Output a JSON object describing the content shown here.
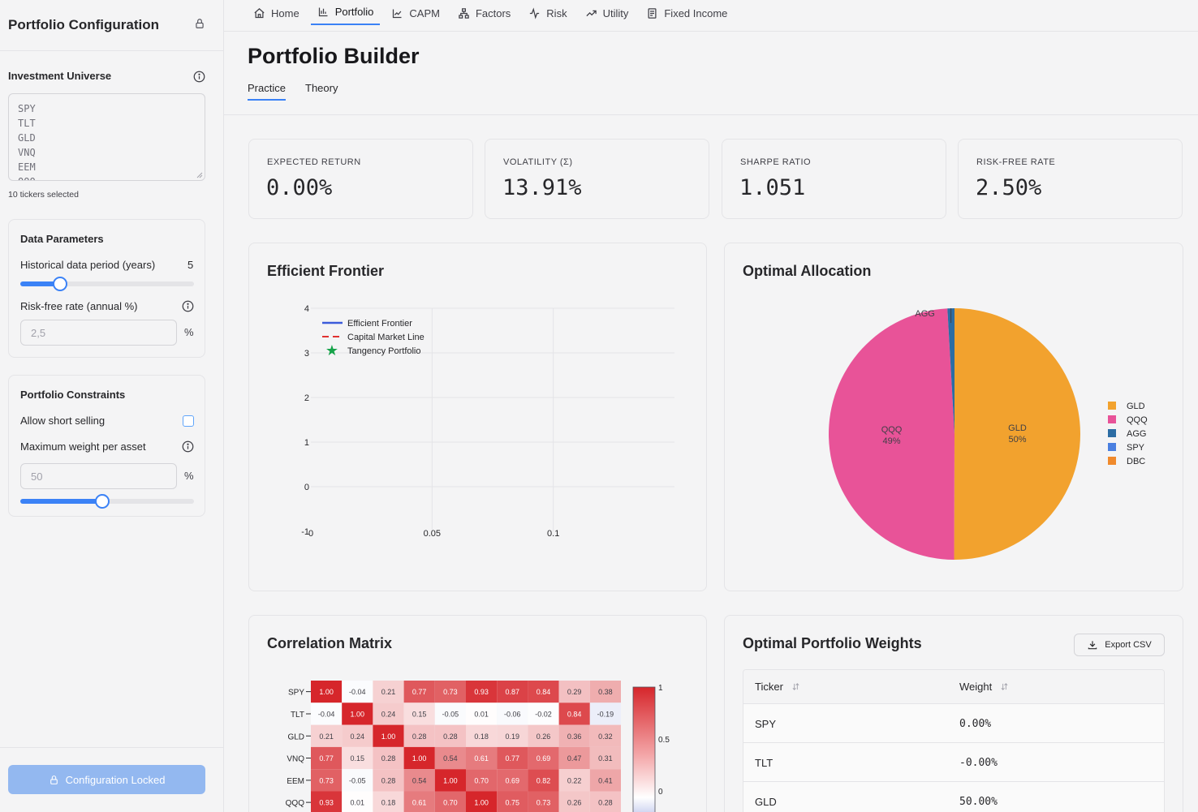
{
  "sidebar": {
    "title": "Portfolio Configuration",
    "universe_label": "Investment Universe",
    "tickers_text": "SPY\nTLT\nGLD\nVNQ\nEEM\nQQQ",
    "tickers_selected": "10 tickers selected",
    "data_params": {
      "title": "Data Parameters",
      "history_label": "Historical data period (years)",
      "history_value": "5",
      "history_fraction": 0.23,
      "rf_label": "Risk-free rate (annual %)",
      "rf_placeholder": "2,5",
      "pct": "%"
    },
    "constraints": {
      "title": "Portfolio Constraints",
      "short_label": "Allow short selling",
      "short_checked": false,
      "maxw_label": "Maximum weight per asset",
      "maxw_placeholder": "50",
      "maxw_fraction": 0.47,
      "pct": "%"
    },
    "locked_button": "Configuration Locked"
  },
  "nav": {
    "items": [
      {
        "label": "Home",
        "icon": "home-icon"
      },
      {
        "label": "Portfolio",
        "icon": "bar-chart-icon",
        "active": true
      },
      {
        "label": "CAPM",
        "icon": "line-chart-icon"
      },
      {
        "label": "Factors",
        "icon": "network-icon"
      },
      {
        "label": "Risk",
        "icon": "activity-icon"
      },
      {
        "label": "Utility",
        "icon": "trending-up-icon"
      },
      {
        "label": "Fixed Income",
        "icon": "document-icon"
      }
    ]
  },
  "page": {
    "title": "Portfolio Builder",
    "tabs": [
      "Practice",
      "Theory"
    ]
  },
  "metrics": [
    {
      "label": "EXPECTED RETURN",
      "value": "0.00%"
    },
    {
      "label": "VOLATILITY (Σ)",
      "value": "13.91%"
    },
    {
      "label": "SHARPE RATIO",
      "value": "1.051"
    },
    {
      "label": "RISK-FREE RATE",
      "value": "2.50%"
    }
  ],
  "frontier": {
    "title": "Efficient Frontier"
  },
  "allocation": {
    "title": "Optimal Allocation"
  },
  "correlation": {
    "title": "Correlation Matrix"
  },
  "weights": {
    "title": "Optimal Portfolio Weights",
    "export_label": "Export CSV",
    "columns": [
      "Ticker",
      "Weight"
    ],
    "rows": [
      {
        "ticker": "SPY",
        "weight": "0.00%"
      },
      {
        "ticker": "TLT",
        "weight": "-0.00%"
      },
      {
        "ticker": "GLD",
        "weight": "50.00%"
      }
    ]
  },
  "colors": {
    "accent": "#3b82f6",
    "gld": "#f2a22e",
    "qqq": "#e85398",
    "agg": "#2c6da4",
    "spy": "#4a7fe0",
    "dbc": "#f08a2c"
  },
  "chart_data": [
    {
      "type": "line",
      "title": "Efficient Frontier",
      "xlim": [
        0,
        0.15
      ],
      "ylim": [
        -1,
        4
      ],
      "x_ticks": [
        "0",
        "0.05",
        "0.1"
      ],
      "y_ticks": [
        "-1",
        "0",
        "1",
        "2",
        "3",
        "4"
      ],
      "legend": [
        "Efficient Frontier",
        "Capital Market Line",
        "Tangency Portfolio"
      ],
      "legend_position": "top-left",
      "series": [
        {
          "name": "Efficient Frontier",
          "x": [],
          "y": []
        },
        {
          "name": "Capital Market Line",
          "x": [],
          "y": []
        },
        {
          "name": "Tangency Portfolio",
          "x": [],
          "y": []
        }
      ],
      "grid": true
    },
    {
      "type": "pie",
      "title": "Optimal Allocation",
      "legend": [
        "GLD",
        "QQQ",
        "AGG",
        "SPY",
        "DBC"
      ],
      "legend_position": "right",
      "slices": [
        {
          "label": "GLD",
          "value": 50,
          "text": "GLD\n50%"
        },
        {
          "label": "QQQ",
          "value": 49,
          "text": "QQQ\n49%"
        },
        {
          "label": "AGG",
          "value": 0.9,
          "text": "AGG"
        },
        {
          "label": "SPY",
          "value": 0
        },
        {
          "label": "DBC",
          "value": 0
        }
      ]
    },
    {
      "type": "heatmap",
      "title": "Correlation Matrix",
      "row_labels": [
        "SPY",
        "TLT",
        "GLD",
        "VNQ",
        "EEM",
        "QQQ"
      ],
      "values": [
        [
          1.0,
          -0.04,
          0.21,
          0.77,
          0.73,
          0.93,
          0.87,
          0.84,
          0.29,
          0.38
        ],
        [
          -0.04,
          1.0,
          0.24,
          0.15,
          -0.05,
          0.01,
          -0.06,
          -0.02,
          0.84,
          -0.19
        ],
        [
          0.21,
          0.24,
          1.0,
          0.28,
          0.28,
          0.18,
          0.19,
          0.26,
          0.36,
          0.32
        ],
        [
          0.77,
          0.15,
          0.28,
          1.0,
          0.54,
          0.61,
          0.77,
          0.69,
          0.47,
          0.31
        ],
        [
          0.73,
          -0.05,
          0.28,
          0.54,
          1.0,
          0.7,
          0.69,
          0.82,
          0.22,
          0.41
        ],
        [
          0.93,
          0.01,
          0.18,
          0.61,
          0.7,
          1.0,
          0.75,
          0.73,
          0.26,
          0.28
        ]
      ],
      "colorbar_ticks": [
        "1",
        "0.5",
        "0"
      ]
    }
  ]
}
